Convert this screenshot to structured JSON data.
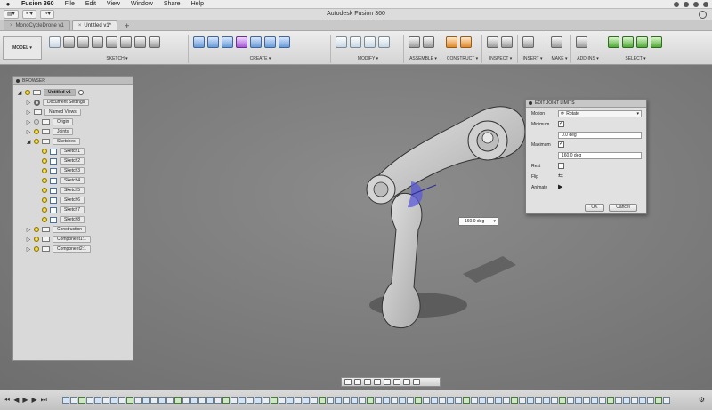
{
  "menubar": {
    "apple": "",
    "items": [
      "Fusion 360",
      "File",
      "Edit",
      "View",
      "Window",
      "Share",
      "Help"
    ]
  },
  "window": {
    "title": "Autodesk Fusion 360"
  },
  "quick_access": {
    "file_btn": "▤▾",
    "undo_btn": "↶▾",
    "redo_btn": "↷▾"
  },
  "tabs": [
    {
      "label": "MonoCycleDrone v1"
    },
    {
      "label": "Untitled v1*"
    }
  ],
  "ribbon": {
    "workspace": "MODEL ▾",
    "groups": [
      {
        "label": "SKETCH ▾",
        "n": 8
      },
      {
        "label": "CREATE ▾",
        "n": 7
      },
      {
        "label": "MODIFY ▾",
        "n": 4
      },
      {
        "label": "ASSEMBLE ▾",
        "n": 3
      },
      {
        "label": "CONSTRUCT ▾",
        "n": 2
      },
      {
        "label": "INSPECT ▾",
        "n": 2
      },
      {
        "label": "INSERT ▾",
        "n": 1
      },
      {
        "label": "MAKE ▾",
        "n": 1
      },
      {
        "label": "ADD-INS ▾",
        "n": 1
      },
      {
        "label": "SELECT ▾",
        "n": 4
      }
    ]
  },
  "browser": {
    "title": "BROWSER",
    "root": "Untitled v1",
    "items": [
      {
        "label": "Document Settings"
      },
      {
        "label": "Named Views"
      },
      {
        "label": "Origin"
      },
      {
        "label": "Joints"
      },
      {
        "label": "Sketches"
      },
      {
        "label": "Sketch1"
      },
      {
        "label": "Sketch2"
      },
      {
        "label": "Sketch3"
      },
      {
        "label": "Sketch4"
      },
      {
        "label": "Sketch5"
      },
      {
        "label": "Sketch6"
      },
      {
        "label": "Sketch7"
      },
      {
        "label": "Sketch8"
      },
      {
        "label": "Construction"
      },
      {
        "label": "Component1:1"
      },
      {
        "label": "Component2:1"
      }
    ]
  },
  "dialog": {
    "title": "EDIT JOINT LIMITS",
    "motion_label": "Motion",
    "motion_value": "Rotate",
    "minimum_label": "Minimum",
    "minimum_value": "0.0 deg",
    "maximum_label": "Maximum",
    "maximum_value": "160.0 deg",
    "rest_label": "Rest",
    "flip_label": "Flip",
    "animate_label": "Animate",
    "ok": "OK",
    "cancel": "Cancel"
  },
  "callout": {
    "value": "160.0 deg"
  },
  "colors": {
    "viewport": "#7e7e7e",
    "joint_highlight": "#5a5ad8"
  }
}
